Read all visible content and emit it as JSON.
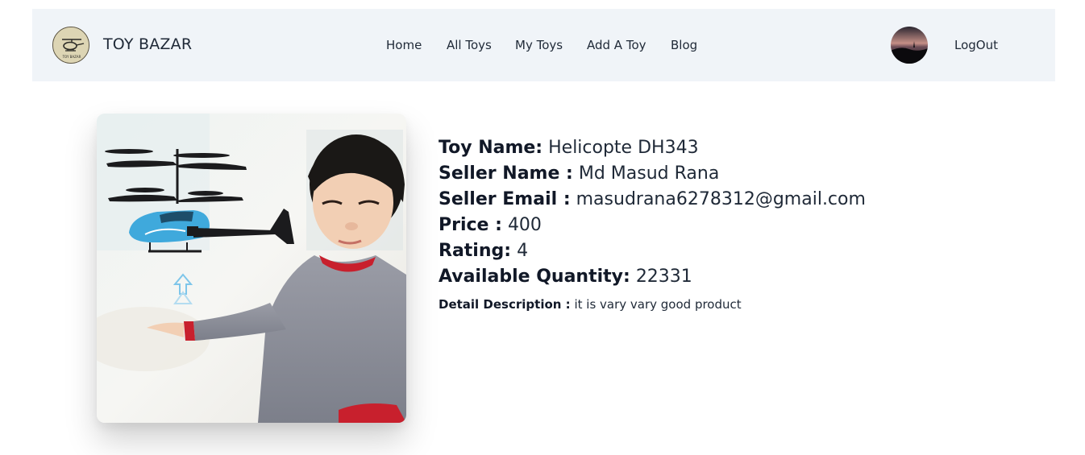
{
  "header": {
    "brand": "TOY BAZAR",
    "logo_text": "TOY BAZAR",
    "logo_icon": "helicopter-icon",
    "nav": [
      {
        "label": "Home"
      },
      {
        "label": "All Toys"
      },
      {
        "label": "My Toys"
      },
      {
        "label": "Add A Toy"
      },
      {
        "label": "Blog"
      }
    ],
    "logout_label": "LogOut"
  },
  "product": {
    "image_icon": "helicopter-toy-photo",
    "name_label": "Toy Name:",
    "name": "Helicopte DH343",
    "seller_label": "Seller Name :",
    "seller": "Md Masud Rana",
    "email_label": "Seller Email :",
    "email": "masudrana6278312@gmail.com",
    "price_label": "Price :",
    "price": "400",
    "rating_label": "Rating:",
    "rating": "4",
    "quantity_label": "Available Quantity:",
    "quantity": "22331",
    "description_label": "Detail Description :",
    "description": "it is vary vary good product"
  },
  "colors": {
    "navbar_bg": "#f0f4f8",
    "text": "#1f2937",
    "toy_blue": "#3fa9dc",
    "sweater": "#8a8d98",
    "collar_red": "#c8202d"
  }
}
